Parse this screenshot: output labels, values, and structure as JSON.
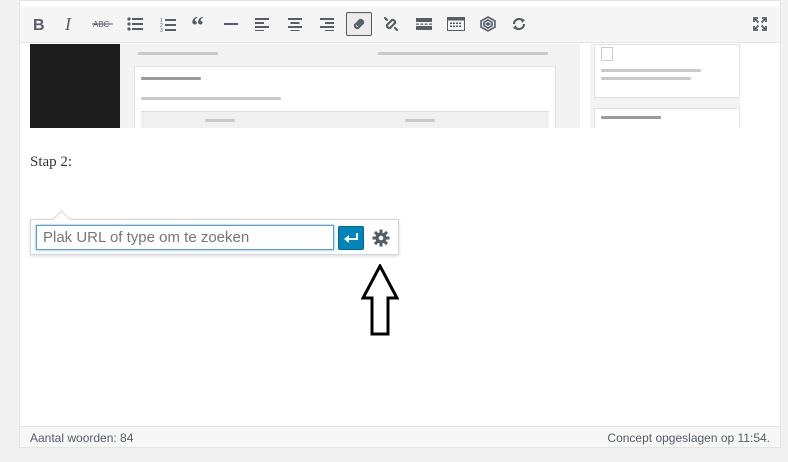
{
  "toolbar": {
    "buttons": [
      {
        "name": "bold",
        "icon": "bold-icon"
      },
      {
        "name": "italic",
        "icon": "italic-icon"
      },
      {
        "name": "strikethrough",
        "icon": "strikethrough-icon",
        "label": "ABC"
      },
      {
        "name": "bullet-list",
        "icon": "bullet-list-icon"
      },
      {
        "name": "numbered-list",
        "icon": "numbered-list-icon"
      },
      {
        "name": "blockquote",
        "icon": "quote-icon"
      },
      {
        "name": "horizontal-line",
        "icon": "horizontal-line-icon"
      },
      {
        "name": "align-left",
        "icon": "align-left-icon"
      },
      {
        "name": "align-center",
        "icon": "align-center-icon"
      },
      {
        "name": "align-right",
        "icon": "align-right-icon"
      },
      {
        "name": "insert-link",
        "icon": "link-icon",
        "active": true
      },
      {
        "name": "remove-link",
        "icon": "unlink-icon"
      },
      {
        "name": "read-more",
        "icon": "read-more-icon"
      },
      {
        "name": "toolbar-toggle",
        "icon": "keyboard-icon"
      },
      {
        "name": "layers",
        "icon": "layers-icon"
      },
      {
        "name": "refresh",
        "icon": "refresh-icon"
      },
      {
        "name": "fullscreen",
        "icon": "fullscreen-icon"
      }
    ],
    "strike_label": "ABC"
  },
  "content": {
    "paragraph": "Stap 2:"
  },
  "link_popover": {
    "placeholder": "Plak URL of type om te zoeken",
    "value": "",
    "apply_icon": "enter-icon",
    "settings_icon": "gear-icon"
  },
  "annotation": {
    "icon": "up-arrow-icon"
  },
  "statusbar": {
    "word_count": "Aantal woorden: 84",
    "save_status": "Concept opgeslagen op 11:54."
  },
  "colors": {
    "accent": "#0085ba",
    "focus_border": "#5b9dd9",
    "icon": "#555d66"
  }
}
